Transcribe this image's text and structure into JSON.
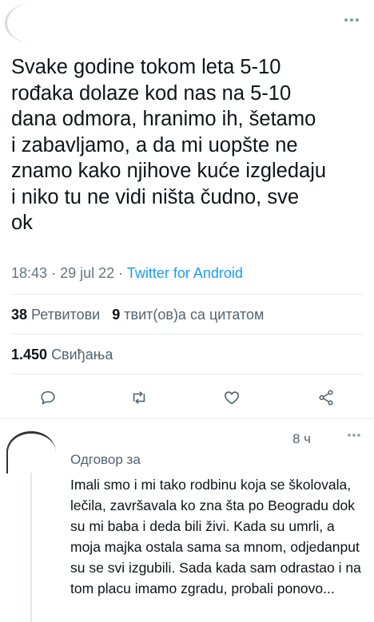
{
  "tweet": {
    "text": "Svake godine tokom leta 5-10\nrođaka dolaze kod nas na 5-10\ndana odmora, hranimo ih, šetamo\ni zabavljamo, a da mi uopšte ne\nznamo kako njihove kuće izgledaju\ni niko tu ne vidi ništa čudno, sve\nok",
    "time": "18:43",
    "date": "29 jul 22",
    "separator": "·",
    "source": "Twitter for Android",
    "retweets_count": "38",
    "retweets_label": "Ретвитови",
    "quotes_count": "9",
    "quotes_label": "твит(ов)а са цитатом",
    "likes_count": "1.450",
    "likes_label": "Свиђања"
  },
  "actions": [
    "reply-icon",
    "retweet-icon",
    "like-icon",
    "share-icon"
  ],
  "header": {
    "more_icon": "more-icon"
  },
  "reply": {
    "time": "8 ч",
    "replying_to": "Одговор за",
    "text": "Imali smo i mi tako rodbinu koja se školovala, lečila, završavala ko zna šta po Beogradu dok su mi baba i deda bili živi. Kada su umrli, a moja majka ostala sama sa mnom, odjedanput su se svi izgubili. Sada kada sam odrastao i na tom placu imamo zgradu, probali ponovo..."
  },
  "colors": {
    "accent": "#1d9bf0",
    "text": "#0f1419",
    "muted": "#536471"
  }
}
